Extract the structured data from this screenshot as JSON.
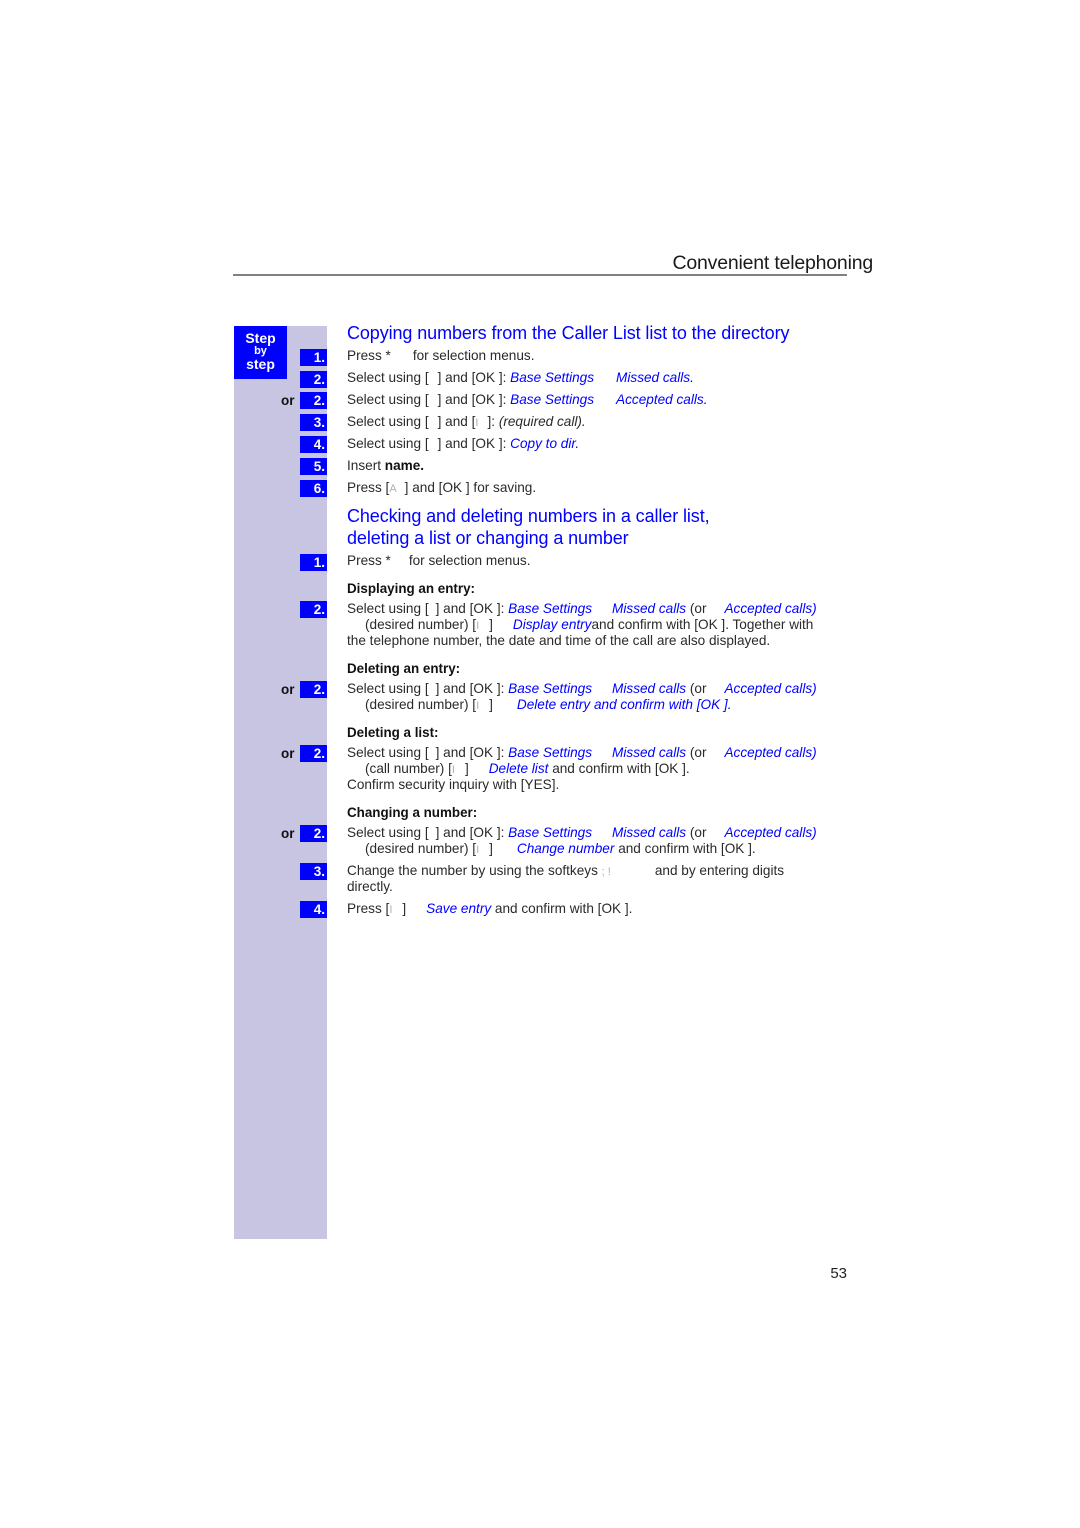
{
  "header": {
    "title": "Convenient telephoning"
  },
  "sidebar": {
    "badge": {
      "line1": "Step",
      "line2": "by",
      "line3": "step"
    },
    "or_label": "or",
    "steps": {
      "s1_1": "1.",
      "s1_2": "2.",
      "s1_2b": "2.",
      "s1_3": "3.",
      "s1_4": "4.",
      "s1_5": "5.",
      "s1_6": "6.",
      "s2_1": "1.",
      "s2_2": "2.",
      "s2_2b": "2.",
      "s2_2c": "2.",
      "s2_2d": "2.",
      "s2_3": "3.",
      "s2_4": "4."
    }
  },
  "section1": {
    "title": "Copying numbers from the Caller List list to the directory",
    "l1": {
      "a": "Press *",
      "b": "for selection menus."
    },
    "l2": {
      "a": "Select using [",
      "b": "] and [OK ]:",
      "c": "Base Settings",
      "d": "Missed calls."
    },
    "l3": {
      "a": "Select using [",
      "b": "] and [OK ]:",
      "c": "Base Settings",
      "d": "Accepted calls."
    },
    "l4": {
      "a": "Select using [",
      "b": "] and [",
      "k": "I",
      "c": "]:",
      "d": "(required call)."
    },
    "l5": {
      "a": "Select using [",
      "b": "] and [OK ]:",
      "c": "Copy to dir."
    },
    "l6": {
      "a": "Insert",
      "b": "name."
    },
    "l7": {
      "a": "Press [",
      "k": "A",
      "b": "] and [OK ] for saving."
    }
  },
  "section2": {
    "title_line1": "Checking and deleting numbers in a caller list,",
    "title_line2": "deleting a list or changing a number",
    "l1": {
      "a": "Press *",
      "b": "for selection menus."
    },
    "display": {
      "heading": "Displaying an entry:",
      "a": "Select using [",
      "b": "] and [OK ]:",
      "c": "Base Settings",
      "d": "Missed calls",
      "e": "(or",
      "f": "Accepted calls)",
      "g": "(desired number) [",
      "k": "I",
      "h": "]",
      "i": "Display entry",
      "j": "and confirm with [OK ]. Together with",
      "l": "the telephone number, the date and time of the call are also displayed."
    },
    "delete_entry": {
      "heading": "Deleting an entry:",
      "a": "Select using [",
      "b": "] and [OK ]:",
      "c": "Base Settings",
      "d": "Missed calls",
      "e": "(or",
      "f": "Accepted calls)",
      "g": "(desired number) [",
      "k": "I",
      "h": "]",
      "i": "Delete entry and confirm with [OK ]."
    },
    "delete_list": {
      "heading": "Deleting a list:",
      "a": "Select using [",
      "b": "] and [OK ]:",
      "c": "Base Settings",
      "d": "Missed calls",
      "e": "(or",
      "f": "Accepted calls)",
      "g": "(call number) [",
      "k": "I",
      "h": "]",
      "i": "Delete list",
      "j": "and confirm with [OK ].",
      "l": "Confirm security inquiry with [YES]."
    },
    "change": {
      "heading": "Changing a number:",
      "a": "Select using [",
      "b": "] and [OK ]:",
      "c": "Base Settings",
      "d": "Missed calls",
      "e": "(or",
      "f": "Accepted calls)",
      "g": "(desired number) [",
      "k": "I",
      "h": "]",
      "i": "Change number",
      "j": "and confirm with [OK ].",
      "s3a": "Change the number by using the softkeys",
      "s3k": "; !",
      "s3b": "and by entering digits",
      "s3c": "directly.",
      "s4a": "Press [",
      "s4k": "I",
      "s4b": "]",
      "s4c": "Save entry",
      "s4d": "and confirm with [OK ]."
    }
  },
  "footer": {
    "page_number": "53"
  }
}
